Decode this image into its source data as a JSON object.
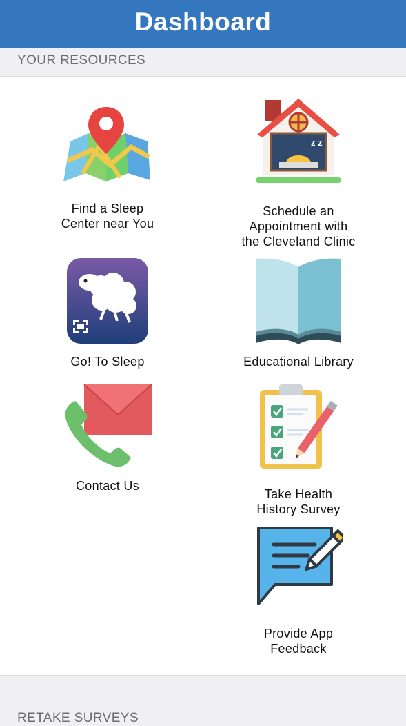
{
  "header": {
    "title": "Dashboard"
  },
  "sections": {
    "resources": "YOUR RESOURCES",
    "retake": "RETAKE SURVEYS"
  },
  "tiles": {
    "find_center": {
      "label": "Find a Sleep\nCenter near You",
      "icon": "map-pin-icon"
    },
    "schedule": {
      "label": "Schedule an\nAppointment with\nthe Cleveland Clinic",
      "icon": "house-sleep-icon"
    },
    "go_to_sleep": {
      "label": "Go! To Sleep",
      "icon": "sheep-app-icon"
    },
    "library": {
      "label": "Educational Library",
      "icon": "open-book-icon"
    },
    "contact": {
      "label": "Contact Us",
      "icon": "phone-mail-icon"
    },
    "health_history": {
      "label": "Take Health\nHistory Survey",
      "icon": "clipboard-checklist-icon"
    },
    "feedback": {
      "label": "Provide App\nFeedback",
      "icon": "chat-pencil-icon"
    }
  },
  "colors": {
    "header": "#3477be",
    "background": "#efeff4",
    "section_text": "#6d6d72"
  }
}
